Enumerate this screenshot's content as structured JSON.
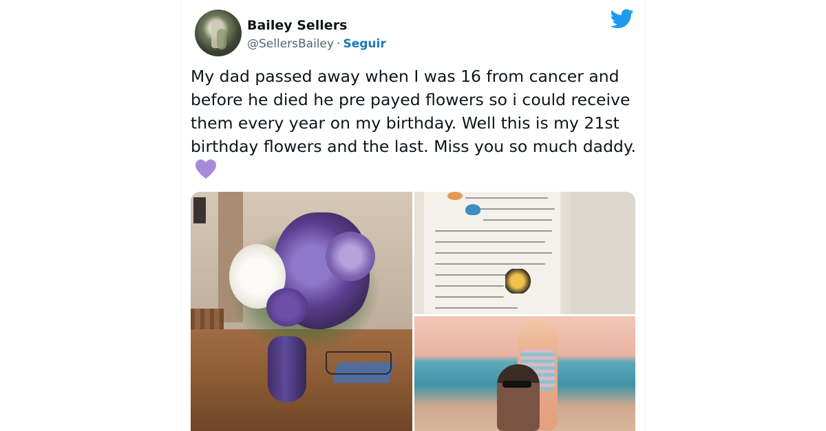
{
  "tweet": {
    "author_name": "Bailey Sellers",
    "handle": "@SellersBailey",
    "separator": "·",
    "follow_label": "Seguir",
    "text": "My dad passed away when I was 16 from cancer and before he died he pre payed flowers so i could receive them every year on my birthday. Well this is my 21st birthday flowers and the last. Miss you so much daddy.",
    "emoji": "purple-heart",
    "avatar_icon": "profile-avatar",
    "platform_icon": "twitter-bird-icon"
  },
  "media": {
    "photos": [
      {
        "name": "flowers-photo"
      },
      {
        "name": "letter-photo"
      },
      {
        "name": "beach-photo"
      }
    ]
  },
  "colors": {
    "text": "#0f1419",
    "secondary": "#536471",
    "follow": "#1b75bb",
    "twitter_blue": "#1d9bf0",
    "heart": "#a88bd8"
  }
}
